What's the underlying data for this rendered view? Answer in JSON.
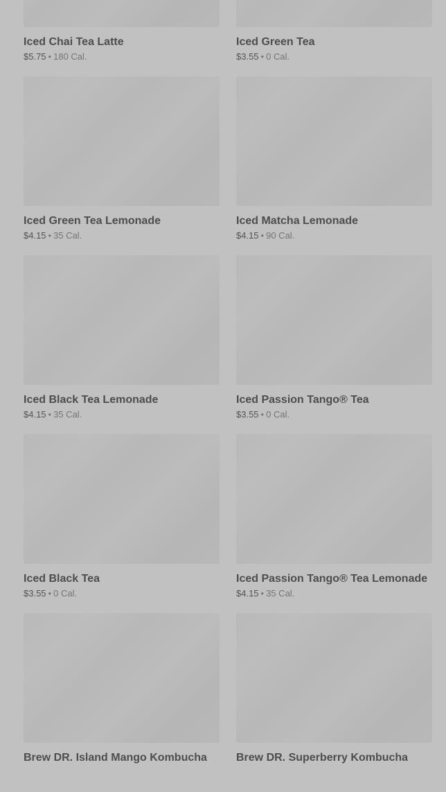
{
  "products": [
    {
      "name": "Iced Chai Tea Latte",
      "price": "$5.75",
      "calories": "180 Cal."
    },
    {
      "name": "Iced Green Tea",
      "price": "$3.55",
      "calories": "0 Cal."
    },
    {
      "name": "Iced Green Tea Lemonade",
      "price": "$4.15",
      "calories": "35 Cal."
    },
    {
      "name": "Iced Matcha Lemonade",
      "price": "$4.15",
      "calories": "90 Cal."
    },
    {
      "name": "Iced Black Tea Lemonade",
      "price": "$4.15",
      "calories": "35 Cal."
    },
    {
      "name": "Iced Passion Tango® Tea",
      "price": "$3.55",
      "calories": "0 Cal."
    },
    {
      "name": "Iced Black Tea",
      "price": "$3.55",
      "calories": "0 Cal."
    },
    {
      "name": "Iced Passion Tango® Tea Lemonade",
      "price": "$4.15",
      "calories": "35 Cal."
    },
    {
      "name": "Brew DR. Island Mango Kombucha",
      "price": "",
      "calories": ""
    },
    {
      "name": "Brew DR. Superberry Kombucha",
      "price": "",
      "calories": ""
    }
  ],
  "separator": "•"
}
